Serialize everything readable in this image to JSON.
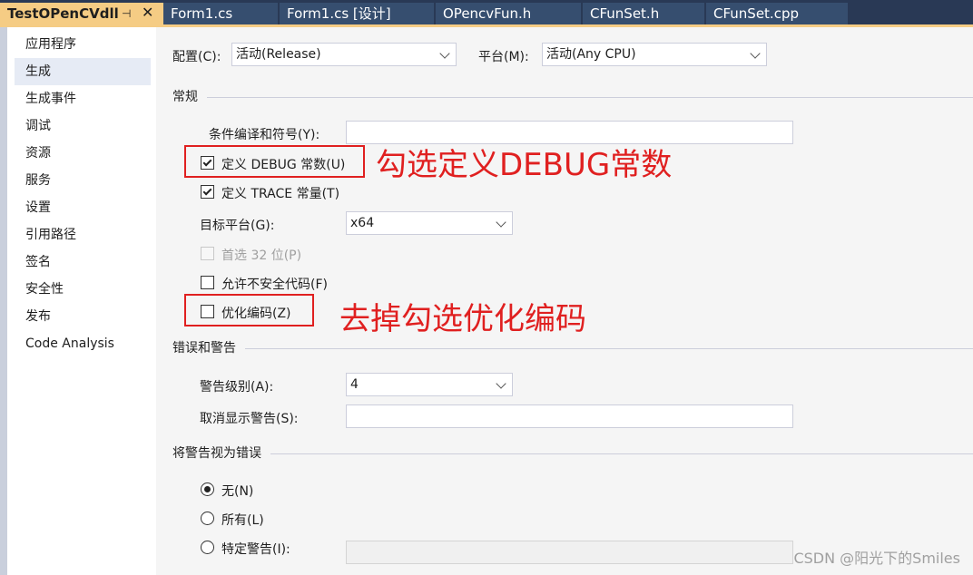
{
  "tabs": [
    {
      "label": "TestOPenCVdll",
      "active": true,
      "pin_icon": "pin-icon",
      "close_icon": "close-icon"
    },
    {
      "label": "Form1.cs"
    },
    {
      "label": "Form1.cs [设计]"
    },
    {
      "label": "OPencvFun.h"
    },
    {
      "label": "CFunSet.h"
    },
    {
      "label": "CFunSet.cpp"
    }
  ],
  "sidebar": {
    "items": [
      {
        "label": "应用程序"
      },
      {
        "label": "生成",
        "selected": true
      },
      {
        "label": "生成事件"
      },
      {
        "label": "调试"
      },
      {
        "label": "资源"
      },
      {
        "label": "服务"
      },
      {
        "label": "设置"
      },
      {
        "label": "引用路径"
      },
      {
        "label": "签名"
      },
      {
        "label": "安全性"
      },
      {
        "label": "发布"
      },
      {
        "label": "Code Analysis"
      }
    ]
  },
  "config": {
    "config_label": "配置(C):",
    "config_value": "活动(Release)",
    "platform_label": "平台(M):",
    "platform_value": "活动(Any CPU)"
  },
  "general": {
    "title": "常规",
    "symbols_label": "条件编译和符号(Y):",
    "symbols_value": "",
    "define_debug_label": "定义 DEBUG 常数(U)",
    "define_debug_checked": true,
    "define_trace_label": "定义 TRACE 常量(T)",
    "define_trace_checked": true,
    "target_label": "目标平台(G):",
    "target_value": "x64",
    "prefer32_label": "首选 32 位(P)",
    "prefer32_checked": false,
    "unsafe_label": "允许不安全代码(F)",
    "unsafe_checked": false,
    "optimize_label": "优化编码(Z)",
    "optimize_checked": false
  },
  "errors": {
    "title": "错误和警告",
    "warning_level_label": "警告级别(A):",
    "warning_level_value": "4",
    "suppress_label": "取消显示警告(S):",
    "suppress_value": ""
  },
  "treat_warnings": {
    "title": "将警告视为错误",
    "none_label": "无(N)",
    "all_label": "所有(L)",
    "specific_label": "特定警告(I):",
    "selected": "none"
  },
  "annotations": {
    "debug_note": "勾选定义DEBUG常数",
    "optimize_note": "去掉勾选优化编码"
  },
  "watermark": "CSDN @阳光下的Smiles",
  "colors": {
    "tabbar": "#293955",
    "active_tab": "#f5cc84",
    "annotation_red": "#e02020"
  }
}
